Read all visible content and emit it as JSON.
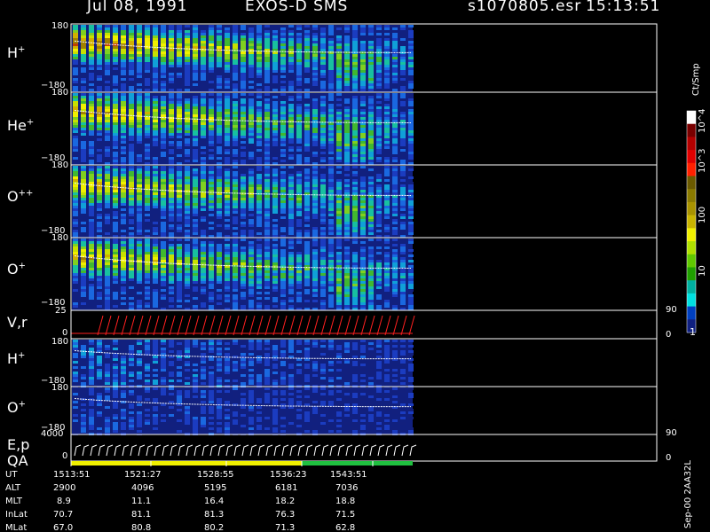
{
  "header": {
    "date": "Jul 08, 1991",
    "instrument": "EXOS-D SMS",
    "file": "s1070805.esr",
    "time": "15:13:51"
  },
  "colorbar": {
    "unit": "Ct/Smp",
    "ticks": [
      "10^4",
      "10^3",
      "100",
      "10",
      "1"
    ],
    "colors": [
      "#ffffff",
      "#7a0000",
      "#b30000",
      "#e00000",
      "#ff2000",
      "#6b5a00",
      "#8a7a00",
      "#a89200",
      "#c8b400",
      "#f0f000",
      "#b0e000",
      "#60c800",
      "#20a000",
      "#00b0a0",
      "#00e0e0",
      "#0040c0",
      "#102080"
    ]
  },
  "panels": [
    {
      "label": "H",
      "sup": "+",
      "ymax": "180",
      "ymin": "−180"
    },
    {
      "label": "He",
      "sup": "+",
      "ymax": "180",
      "ymin": "−180"
    },
    {
      "label": "O",
      "sup": "++",
      "ymax": "180",
      "ymin": "−180"
    },
    {
      "label": "O",
      "sup": "+",
      "ymax": "180",
      "ymin": "−180"
    },
    {
      "label": "V,r",
      "sup": "",
      "ymax": "25",
      "ymin": "0",
      "rmax": "90",
      "rmin": "0"
    },
    {
      "label": "H",
      "sup": "+",
      "ymax": "180",
      "ymin": "−180"
    },
    {
      "label": "O",
      "sup": "+",
      "ymax": "180",
      "ymin": "−180"
    },
    {
      "label": "E,p",
      "sup": "",
      "ymax": "4000",
      "ymin": "0",
      "rmax": "90",
      "rmin": "0"
    }
  ],
  "qa_label": "QA",
  "footer": {
    "row_labels": [
      "UT",
      "ALT",
      "MLT",
      "InLat",
      "MLat"
    ],
    "columns": [
      [
        "1513:51",
        "2900",
        "8.9",
        "70.7",
        "67.0"
      ],
      [
        "1521:27",
        "4096",
        "11.1",
        "81.1",
        "80.8"
      ],
      [
        "1528:55",
        "5195",
        "16.4",
        "81.3",
        "80.2"
      ],
      [
        "1536:23",
        "6181",
        "18.2",
        "76.3",
        "71.3"
      ],
      [
        "1543:51",
        "7036",
        "18.8",
        "71.5",
        "62.8"
      ]
    ],
    "stamp": "Sep-00 2AA32L"
  },
  "chart_data": {
    "type": "heatmap",
    "title": "Jul 08, 1991 EXOS-D SMS",
    "xlabel": "UT",
    "x_ticks": [
      "1513:51",
      "1521:27",
      "1528:55",
      "1536:23",
      "1543:51"
    ],
    "color_scale": "log",
    "clim": [
      1,
      10000
    ],
    "series": [
      {
        "name": "H+",
        "ylim": [
          -180,
          180
        ]
      },
      {
        "name": "He+",
        "ylim": [
          -180,
          180
        ]
      },
      {
        "name": "O++",
        "ylim": [
          -180,
          180
        ]
      },
      {
        "name": "O+",
        "ylim": [
          -180,
          180
        ]
      },
      {
        "name": "V,r",
        "ylim": [
          0,
          25
        ]
      },
      {
        "name": "H+",
        "ylim": [
          -180,
          180
        ]
      },
      {
        "name": "O+",
        "ylim": [
          -180,
          180
        ]
      },
      {
        "name": "E,p",
        "ylim": [
          0,
          4000
        ]
      }
    ]
  }
}
